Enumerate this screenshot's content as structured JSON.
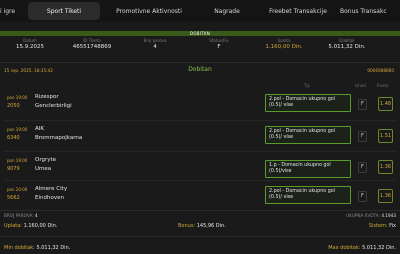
{
  "tabs": [
    {
      "label": "i igre",
      "active": false
    },
    {
      "label": "Sport Tiketi",
      "active": true
    },
    {
      "label": "Promotivne Aktivnosti",
      "active": false
    },
    {
      "label": "Nagrade",
      "active": false
    },
    {
      "label": "Freebet Transakcije",
      "active": false
    },
    {
      "label": "Bonus Transakc",
      "active": false
    }
  ],
  "banner": "DOBITAN",
  "info": [
    {
      "label": "Datum",
      "value": "15.9.2025",
      "gold": false
    },
    {
      "label": "ID Tiketa",
      "value": "46551748869",
      "gold": false
    },
    {
      "label": "Broj parova",
      "value": "4",
      "gold": false
    },
    {
      "label": "Status/Fix",
      "value": "F",
      "gold": false
    },
    {
      "label": "Uplata",
      "value": "1.160,00 Din.",
      "gold": true
    },
    {
      "label": "Dobitak",
      "value": "5.011,32 Din.",
      "gold": false
    }
  ],
  "status": {
    "date": "15 sep. 2025, 18:35:42",
    "result": "Dobitan",
    "code": "0006988660"
  },
  "column_headers": {
    "tip": "Tip",
    "ishod": "Ishod",
    "kvota": "Kvota"
  },
  "matches": [
    {
      "time": "pon 19:00",
      "code": "2050",
      "home": "Rizespor",
      "away": "Genclerbirligi",
      "tip": "2.pol - Domacin ukupno gol (0.5)/ vise",
      "ishod": "F",
      "odd": "1.48"
    },
    {
      "time": "pon 19:00",
      "code": "6340",
      "home": "AIK",
      "away": "Brommapojkarna",
      "tip": "2.pol - Domacin ukupno gol (0.5)/ vise",
      "ishod": "F",
      "odd": "1.51"
    },
    {
      "time": "pon 19:00",
      "code": "9079",
      "home": "Orgryte",
      "away": "Umea",
      "tip": "1.p - Domacin ukupno gol (0.5)/vise",
      "ishod": "F",
      "odd": "1.36"
    },
    {
      "time": "pon 20:00",
      "code": "5662",
      "home": "Almere City",
      "away": "Eindhoven",
      "tip": "2.pol - Domacin ukupno gol (0.5)/ vise",
      "ishod": "F",
      "odd": "1.36"
    }
  ],
  "footer": {
    "pairs_label": "BROJ PAROVA:",
    "pairs_value": "4",
    "total_odds_label": "UKUPNA KVOTA:",
    "total_odds_value": "4.1943",
    "stake_label": "Uplata:",
    "stake_value": "1.160,00 Din.",
    "bonus_label": "Bonus:",
    "bonus_value": "145,96 Din.",
    "system_label": "Sistem:",
    "system_value": "Fix",
    "min_label": "Min dobitak:",
    "min_value": "5.011,32 Din.",
    "max_label": "Max dobitak:",
    "max_value": "5.011,32 Din."
  },
  "colors": {
    "accent_gold": "#d4a93a",
    "win_green": "#8bc34a",
    "banner_green": "#3a5a1a",
    "background": "#1a1a1a"
  }
}
